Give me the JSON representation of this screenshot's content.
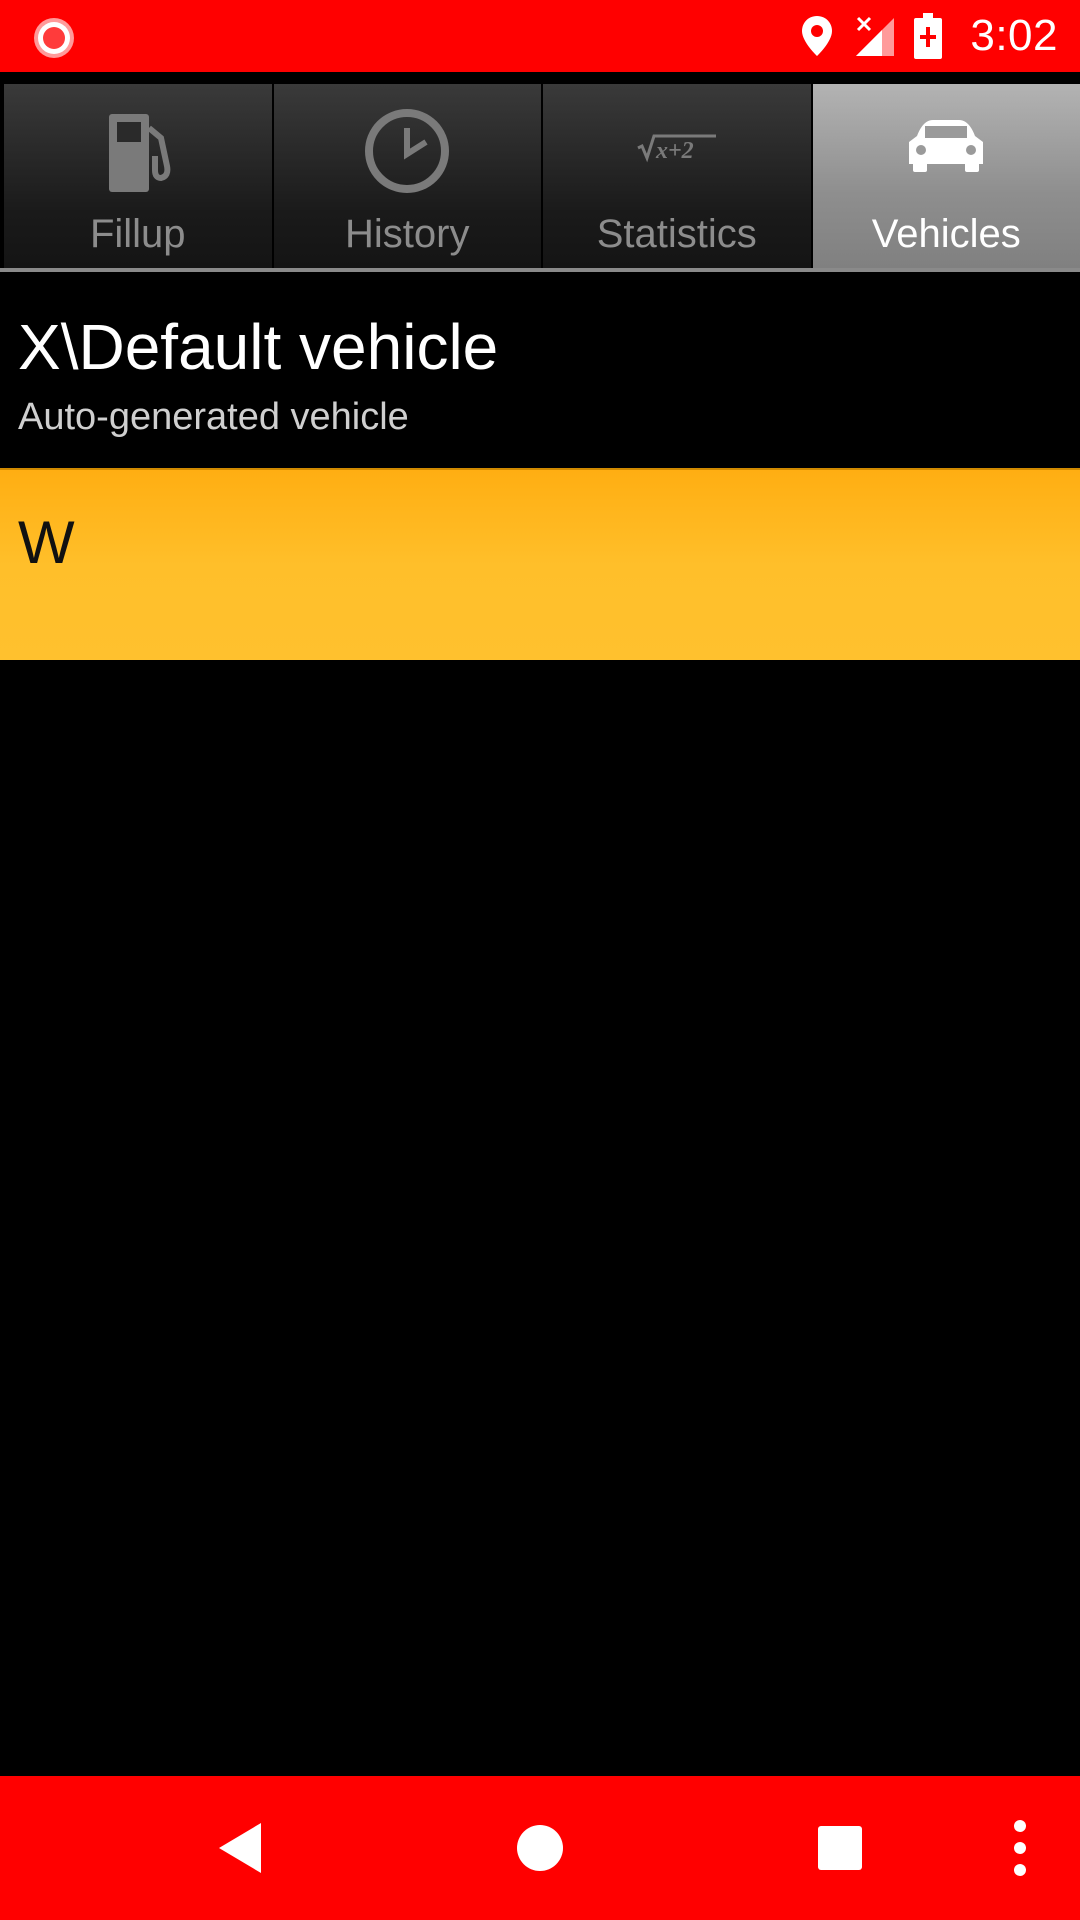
{
  "status_bar": {
    "time": "3:02",
    "icons": [
      "record-icon",
      "location-icon",
      "signal-no-service-icon",
      "battery-charging-icon"
    ],
    "color": "#ff0000"
  },
  "tabs": [
    {
      "label": "Fillup",
      "icon": "fuel-pump-icon",
      "active": false
    },
    {
      "label": "History",
      "icon": "clock-icon",
      "active": false
    },
    {
      "label": "Statistics",
      "icon": "sqrt-x-plus-2-icon",
      "active": false
    },
    {
      "label": "Vehicles",
      "icon": "car-icon",
      "active": true
    }
  ],
  "vehicles": [
    {
      "name": "X\\Default vehicle",
      "description": "Auto-generated vehicle",
      "selected": false
    },
    {
      "name": "W",
      "description": "",
      "selected": true
    }
  ],
  "nav_bar": {
    "buttons": [
      "back-icon",
      "home-icon",
      "recents-icon",
      "more-options-icon"
    ],
    "color": "#ff0000"
  },
  "colors": {
    "selected_item": "#ffbb22",
    "active_tab": "#9e9e9e"
  }
}
